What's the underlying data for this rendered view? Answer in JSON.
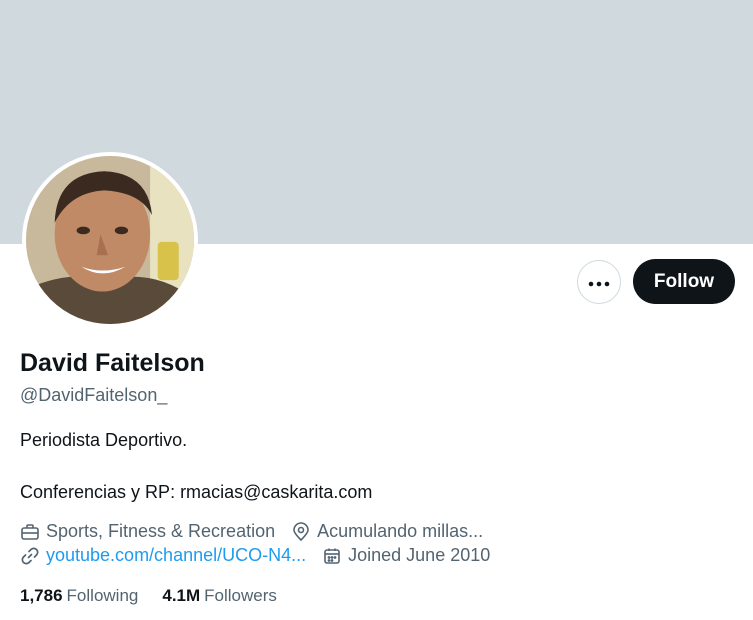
{
  "profile": {
    "name": "David Faitelson",
    "handle": "@DavidFaitelson_",
    "bio_line1": "Periodista Deportivo.",
    "bio_line2": "Conferencias y RP: rmacias@caskarita.com",
    "category": "Sports, Fitness & Recreation",
    "location": "Acumulando millas...",
    "website": "youtube.com/channel/UCO-N4...",
    "joined": "Joined June 2010"
  },
  "actions": {
    "more_label": "•••",
    "follow_label": "Follow"
  },
  "stats": {
    "following_count": "1,786",
    "following_label": "Following",
    "followers_count": "4.1M",
    "followers_label": "Followers"
  },
  "colors": {
    "banner": "#cfd9de",
    "link": "#1d9bf0",
    "secondary_text": "#536471",
    "primary_text": "#0f1419"
  },
  "icons": {
    "category": "briefcase-icon",
    "location": "map-pin-icon",
    "website": "link-icon",
    "joined": "calendar-icon",
    "more": "more-dots-icon"
  }
}
